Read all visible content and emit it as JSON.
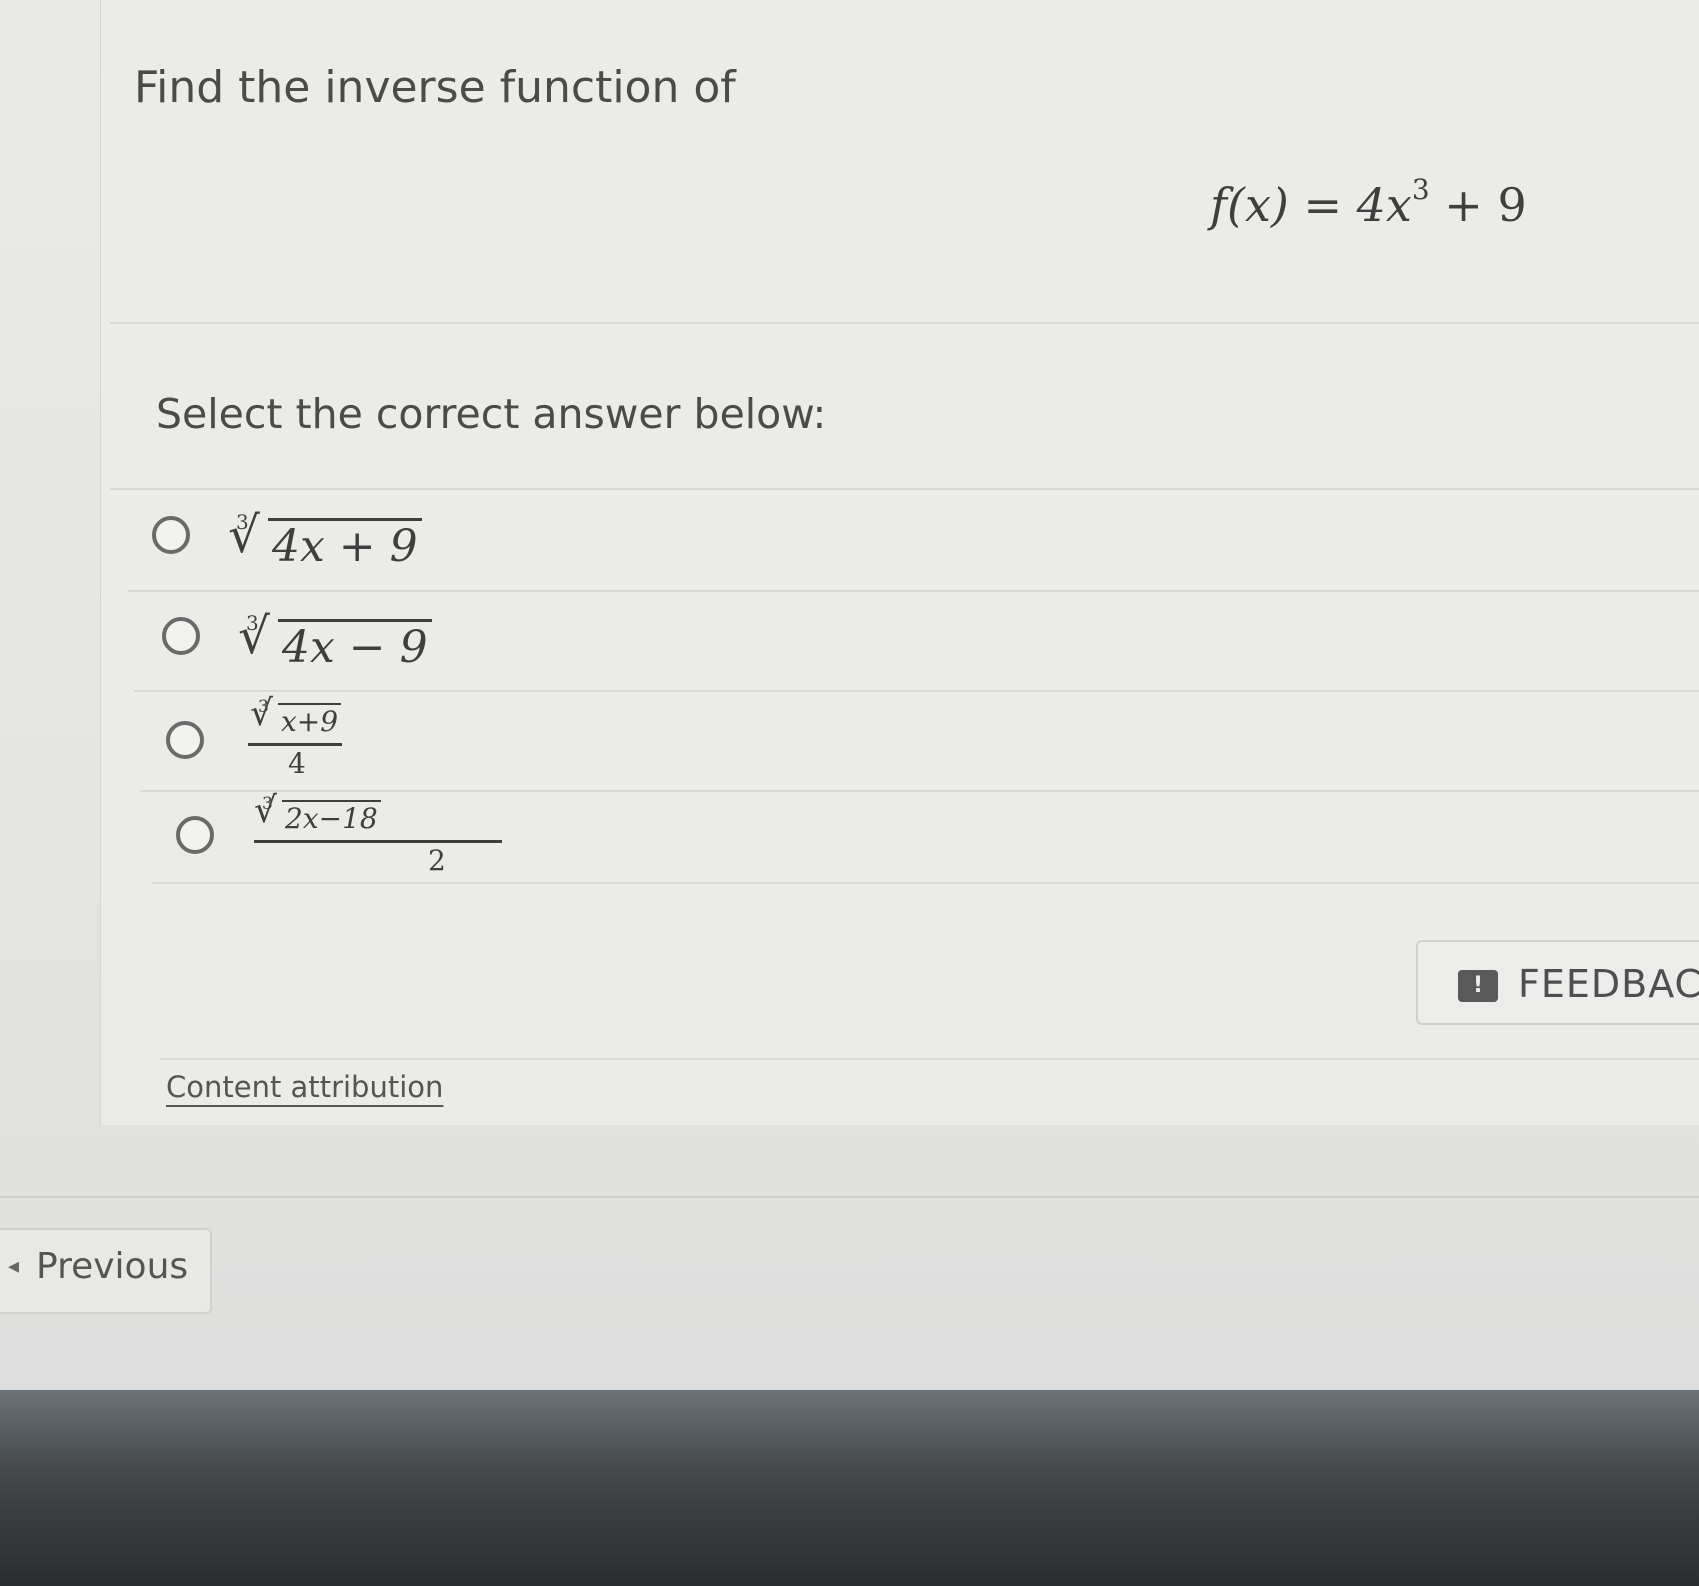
{
  "question": {
    "title": "Find the inverse function of",
    "equation": {
      "lhs": "f(x) = 4x",
      "exponent": "3",
      "rhs": " + 9"
    },
    "prompt": "Select the correct answer below:"
  },
  "options": [
    {
      "index": "3",
      "radicand": "4x + 9",
      "denominator": ""
    },
    {
      "index": "3",
      "radicand": "4x − 9",
      "denominator": ""
    },
    {
      "index": "3",
      "radicand": "x+9",
      "denominator": "4"
    },
    {
      "index": "3",
      "radicand": "2x−18",
      "denominator": "2"
    }
  ],
  "feedback": {
    "label": "FEEDBACK",
    "icon": "exclamation-speech-icon"
  },
  "attribution": {
    "label": "Content attribution"
  },
  "nav": {
    "previous_label": "Previous",
    "previous_icon": "left-caret-icon"
  }
}
